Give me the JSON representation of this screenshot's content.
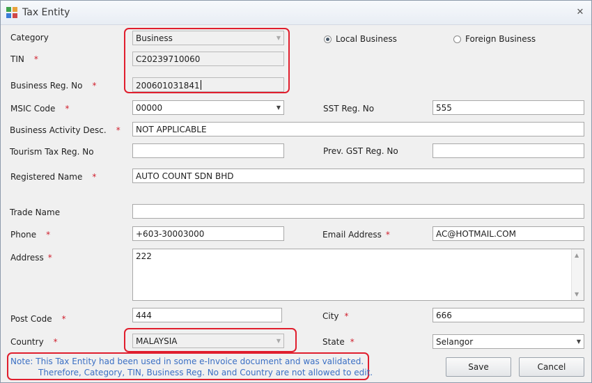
{
  "window": {
    "title": "Tax Entity",
    "close_glyph": "✕"
  },
  "form": {
    "category": {
      "label": "Category",
      "value": "Business"
    },
    "business_type": {
      "local": "Local Business",
      "foreign": "Foreign Business",
      "selected": "local"
    },
    "tin": {
      "label": "TIN",
      "value": "C20239710060"
    },
    "business_reg_no": {
      "label": "Business Reg. No",
      "value": "200601031841"
    },
    "msic_code": {
      "label": "MSIC Code",
      "value": "00000"
    },
    "sst_reg_no": {
      "label": "SST Reg. No",
      "value": "555"
    },
    "business_activity_desc": {
      "label": "Business Activity Desc.",
      "value": "NOT APPLICABLE"
    },
    "tourism_tax_reg_no": {
      "label": "Tourism Tax Reg. No",
      "value": ""
    },
    "prev_gst_reg_no": {
      "label": "Prev. GST Reg. No",
      "value": ""
    },
    "registered_name": {
      "label": "Registered Name",
      "value": "AUTO COUNT SDN BHD"
    },
    "trade_name": {
      "label": "Trade Name",
      "value": ""
    },
    "phone": {
      "label": "Phone",
      "value": "+603-30003000"
    },
    "email": {
      "label": "Email Address",
      "value": "AC@HOTMAIL.COM"
    },
    "address": {
      "label": "Address",
      "value": "222"
    },
    "post_code": {
      "label": "Post Code",
      "value": "444"
    },
    "city": {
      "label": "City",
      "value": "666"
    },
    "country": {
      "label": "Country",
      "value": "MALAYSIA"
    },
    "state": {
      "label": "State",
      "value": "Selangor"
    },
    "required_mark": "*"
  },
  "note": {
    "line1": "Note: This Tax Entity had been used in some e-Invoice document and was validated.",
    "line2": "Therefore, Category, TIN, Business Reg. No and Country are not allowed to edit."
  },
  "buttons": {
    "save": "Save",
    "cancel": "Cancel"
  },
  "colors": {
    "required": "#d0202e",
    "highlight": "#e01e2d",
    "note_text": "#3a6fc4"
  }
}
